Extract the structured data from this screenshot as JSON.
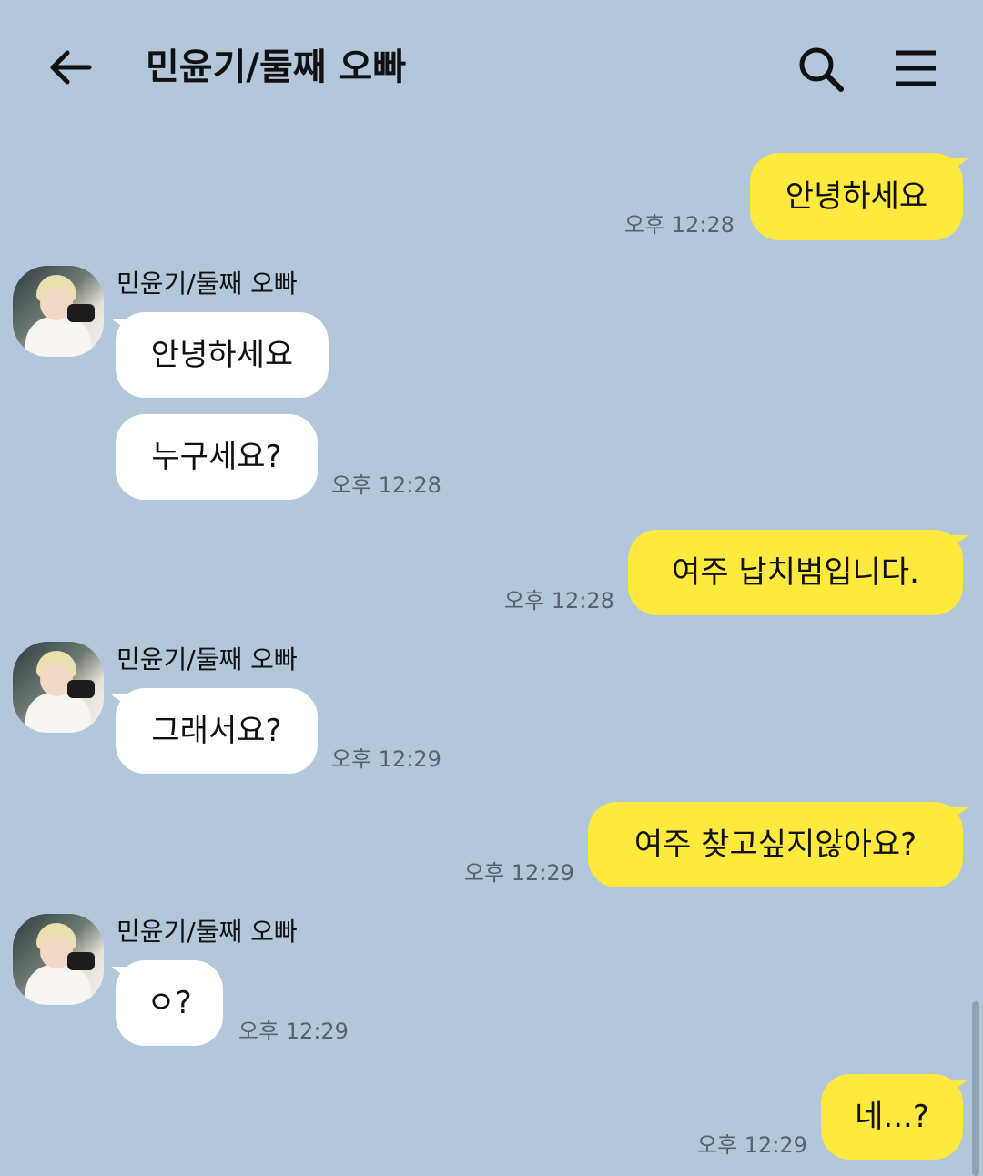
{
  "header": {
    "title": "민윤기/둘째 오빠",
    "back_icon": "arrow-left-icon",
    "search_icon": "search-icon",
    "menu_icon": "hamburger-menu-icon"
  },
  "colors": {
    "background": "#b2c7da",
    "my_bubble": "#fee93f",
    "their_bubble": "#ffffff"
  },
  "messages": [
    {
      "from": "me",
      "text": "안녕하세요",
      "time": "오후 12:28"
    },
    {
      "from": "them",
      "sender": "민윤기/둘째 오빠",
      "text": "안녕하세요"
    },
    {
      "from": "them",
      "text": "누구세요?",
      "time": "오후 12:28"
    },
    {
      "from": "me",
      "text": "여주 납치범입니다.",
      "time": "오후 12:28"
    },
    {
      "from": "them",
      "sender": "민윤기/둘째 오빠",
      "text": "그래서요?",
      "time": "오후 12:29"
    },
    {
      "from": "me",
      "text": "여주 찾고싶지않아요?",
      "time": "오후 12:29"
    },
    {
      "from": "them",
      "sender": "민윤기/둘째 오빠",
      "text": "ㅇ?",
      "time": "오후 12:29"
    },
    {
      "from": "me",
      "text": "네...?",
      "time": "오후 12:29"
    }
  ]
}
